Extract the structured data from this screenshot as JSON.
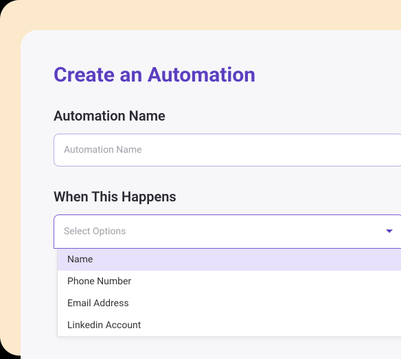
{
  "page": {
    "title": "Create an Automation"
  },
  "automation_name": {
    "label": "Automation Name",
    "placeholder": "Automation Name",
    "value": ""
  },
  "trigger": {
    "label": "When This Happens",
    "placeholder": "Select Options",
    "options": [
      {
        "label": "Name",
        "highlighted": true
      },
      {
        "label": "Phone Number",
        "highlighted": false
      },
      {
        "label": "Email Address",
        "highlighted": false
      },
      {
        "label": "Linkedin Account",
        "highlighted": false
      }
    ]
  }
}
